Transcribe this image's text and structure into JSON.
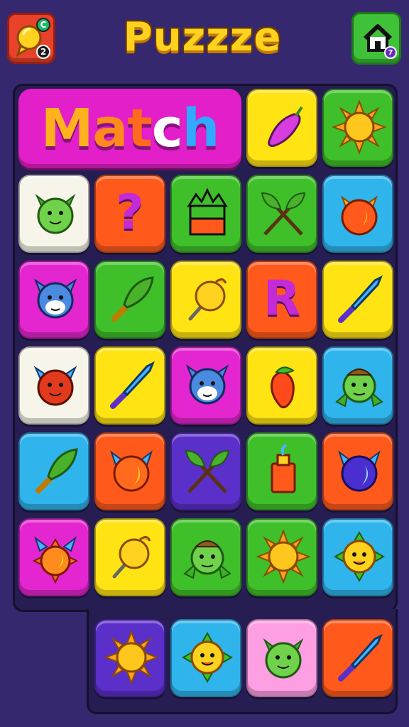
{
  "header": {
    "title": "Puzzze",
    "hint_badge_top": "C",
    "hint_badge_count": "2",
    "home_badge": "7"
  },
  "banner": {
    "letters": [
      "M",
      "a",
      "t",
      "c",
      "h"
    ]
  },
  "colors": {
    "background": "#35286e",
    "board": "#261d52",
    "banner": "#e21fc8",
    "title": "#ffd21f"
  },
  "board": {
    "rows": [
      [
        {
          "color": "yellow",
          "icon": "pepper-icon"
        },
        {
          "color": "green",
          "icon": "sun-icon"
        }
      ],
      [
        {
          "color": "white",
          "icon": "green-creature-icon"
        },
        {
          "color": "red",
          "icon": "question-mark-icon",
          "glyph": "?"
        },
        {
          "color": "green",
          "icon": "crown-pot-icon"
        },
        {
          "color": "green",
          "icon": "crossed-leaves-icon"
        },
        {
          "color": "blue",
          "icon": "orange-creature-icon"
        }
      ],
      [
        {
          "color": "magenta",
          "icon": "blue-creature-icon"
        },
        {
          "color": "green",
          "icon": "leaf-sword-icon"
        },
        {
          "color": "yellow",
          "icon": "fruit-wand-icon"
        },
        {
          "color": "red",
          "icon": "letter-r-icon",
          "glyph": "R"
        },
        {
          "color": "yellow",
          "icon": "crystal-sword-icon"
        }
      ],
      [
        {
          "color": "white",
          "icon": "red-creature-icon"
        },
        {
          "color": "yellow",
          "icon": "crystal-sword-icon"
        },
        {
          "color": "magenta",
          "icon": "blue-creature-icon"
        },
        {
          "color": "yellow",
          "icon": "strawberry-icon"
        },
        {
          "color": "blue",
          "icon": "green-goblin-icon"
        }
      ],
      [
        {
          "color": "blue",
          "icon": "leaf-sword-icon"
        },
        {
          "color": "red",
          "icon": "orange-orb-creature-icon"
        },
        {
          "color": "purple",
          "icon": "crossed-leaves-icon"
        },
        {
          "color": "green",
          "icon": "potion-bottle-icon"
        },
        {
          "color": "red",
          "icon": "purple-orb-creature-icon"
        }
      ],
      [
        {
          "color": "magenta",
          "icon": "sun-creature-icon"
        },
        {
          "color": "yellow",
          "icon": "fruit-wand-icon"
        },
        {
          "color": "green",
          "icon": "green-goblin-icon"
        },
        {
          "color": "green",
          "icon": "sun-icon"
        },
        {
          "color": "blue",
          "icon": "sunflower-face-icon"
        }
      ],
      [
        {
          "color": "purple",
          "icon": "sun-icon"
        },
        {
          "color": "blue",
          "icon": "sunflower-face-icon"
        },
        {
          "color": "pink",
          "icon": "green-creature-icon"
        },
        {
          "color": "red",
          "icon": "crystal-sword-icon"
        }
      ]
    ]
  }
}
